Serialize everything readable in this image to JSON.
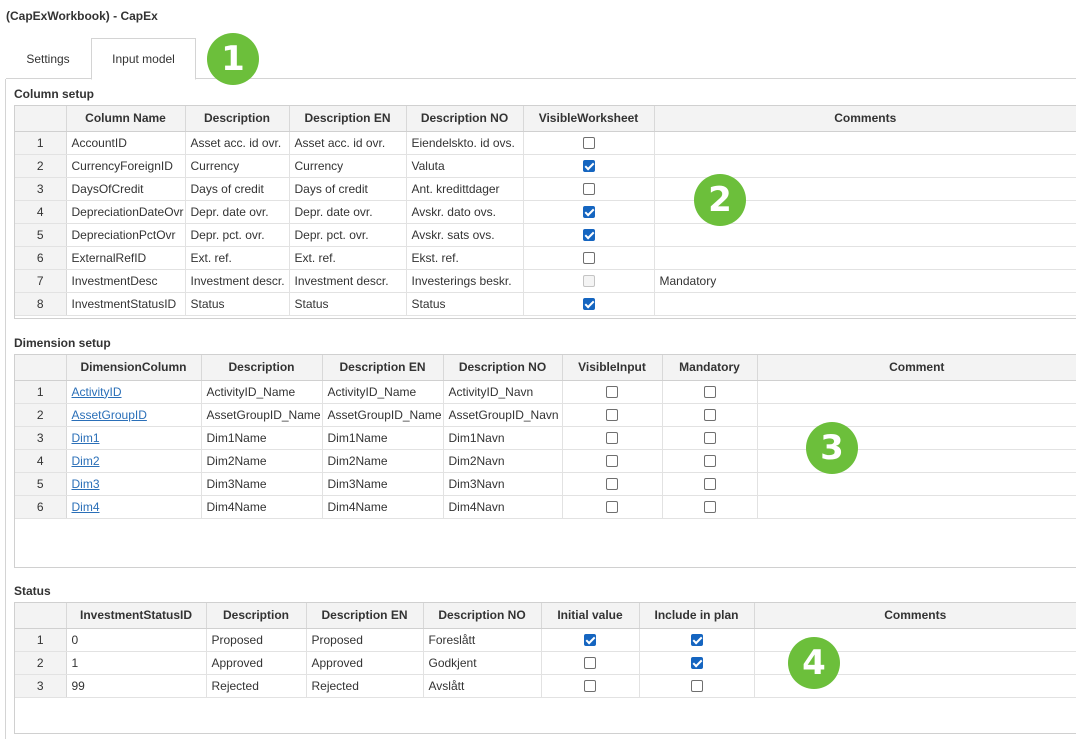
{
  "app_title": "(CapExWorkbook) - CapEx",
  "tabs": [
    {
      "label": "Settings"
    },
    {
      "label": "Input model"
    }
  ],
  "badges": [
    "1",
    "2",
    "3",
    "4"
  ],
  "column_setup": {
    "title": "Column setup",
    "headers": [
      "Column Name",
      "Description",
      "Description EN",
      "Description NO",
      "VisibleWorksheet",
      "Comments"
    ],
    "rows": [
      {
        "n": "1",
        "name": "AccountID",
        "desc": "Asset acc. id ovr.",
        "desc_en": "Asset acc. id ovr.",
        "desc_no": "Eiendelskto. id ovs.",
        "visible": false,
        "disabled": false,
        "comment": ""
      },
      {
        "n": "2",
        "name": "CurrencyForeignID",
        "desc": "Currency",
        "desc_en": "Currency",
        "desc_no": "Valuta",
        "visible": true,
        "disabled": false,
        "comment": ""
      },
      {
        "n": "3",
        "name": "DaysOfCredit",
        "desc": "Days of credit",
        "desc_en": "Days of credit",
        "desc_no": "Ant. kredittdager",
        "visible": false,
        "disabled": false,
        "comment": ""
      },
      {
        "n": "4",
        "name": "DepreciationDateOvr",
        "desc": "Depr. date ovr.",
        "desc_en": "Depr. date ovr.",
        "desc_no": "Avskr. dato ovs.",
        "visible": true,
        "disabled": false,
        "comment": ""
      },
      {
        "n": "5",
        "name": "DepreciationPctOvr",
        "desc": "Depr. pct. ovr.",
        "desc_en": "Depr. pct. ovr.",
        "desc_no": "Avskr. sats ovs.",
        "visible": true,
        "disabled": false,
        "comment": ""
      },
      {
        "n": "6",
        "name": "ExternalRefID",
        "desc": "Ext. ref.",
        "desc_en": "Ext. ref.",
        "desc_no": "Ekst. ref.",
        "visible": false,
        "disabled": false,
        "comment": ""
      },
      {
        "n": "7",
        "name": "InvestmentDesc",
        "desc": "Investment descr.",
        "desc_en": "Investment descr.",
        "desc_no": "Investerings beskr.",
        "visible": false,
        "disabled": true,
        "comment": "Mandatory"
      },
      {
        "n": "8",
        "name": "InvestmentStatusID",
        "desc": "Status",
        "desc_en": "Status",
        "desc_no": "Status",
        "visible": true,
        "disabled": false,
        "comment": ""
      }
    ]
  },
  "dimension_setup": {
    "title": "Dimension setup",
    "headers": [
      "DimensionColumn",
      "Description",
      "Description EN",
      "Description NO",
      "VisibleInput",
      "Mandatory",
      "Comment"
    ],
    "rows": [
      {
        "n": "1",
        "col": "ActivityID",
        "desc": "ActivityID_Name",
        "desc_en": "ActivityID_Name",
        "desc_no": "ActivityID_Navn",
        "visible": false,
        "mandatory": false,
        "comment": ""
      },
      {
        "n": "2",
        "col": "AssetGroupID",
        "desc": "AssetGroupID_Name",
        "desc_en": "AssetGroupID_Name",
        "desc_no": "AssetGroupID_Navn",
        "visible": false,
        "mandatory": false,
        "comment": ""
      },
      {
        "n": "3",
        "col": "Dim1",
        "desc": "Dim1Name",
        "desc_en": "Dim1Name",
        "desc_no": "Dim1Navn",
        "visible": false,
        "mandatory": false,
        "comment": ""
      },
      {
        "n": "4",
        "col": "Dim2",
        "desc": "Dim2Name",
        "desc_en": "Dim2Name",
        "desc_no": "Dim2Navn",
        "visible": false,
        "mandatory": false,
        "comment": ""
      },
      {
        "n": "5",
        "col": "Dim3",
        "desc": "Dim3Name",
        "desc_en": "Dim3Name",
        "desc_no": "Dim3Navn",
        "visible": false,
        "mandatory": false,
        "comment": ""
      },
      {
        "n": "6",
        "col": "Dim4",
        "desc": "Dim4Name",
        "desc_en": "Dim4Name",
        "desc_no": "Dim4Navn",
        "visible": false,
        "mandatory": false,
        "comment": ""
      }
    ]
  },
  "status": {
    "title": "Status",
    "headers": [
      "InvestmentStatusID",
      "Description",
      "Description EN",
      "Description NO",
      "Initial value",
      "Include in plan",
      "Comments"
    ],
    "rows": [
      {
        "n": "1",
        "id": "0",
        "desc": "Proposed",
        "desc_en": "Proposed",
        "desc_no": "Foreslått",
        "initial": true,
        "include": true,
        "comment": ""
      },
      {
        "n": "2",
        "id": "1",
        "desc": "Approved",
        "desc_en": "Approved",
        "desc_no": "Godkjent",
        "initial": false,
        "include": true,
        "comment": ""
      },
      {
        "n": "3",
        "id": "99",
        "desc": "Rejected",
        "desc_en": "Rejected",
        "desc_no": "Avslått",
        "initial": false,
        "include": false,
        "comment": ""
      }
    ]
  },
  "colors": {
    "badge": "#6cbf3b",
    "checkbox_checked": "#1565c0",
    "link": "#2a6fb8",
    "header_bg": "#f3f3f3"
  }
}
